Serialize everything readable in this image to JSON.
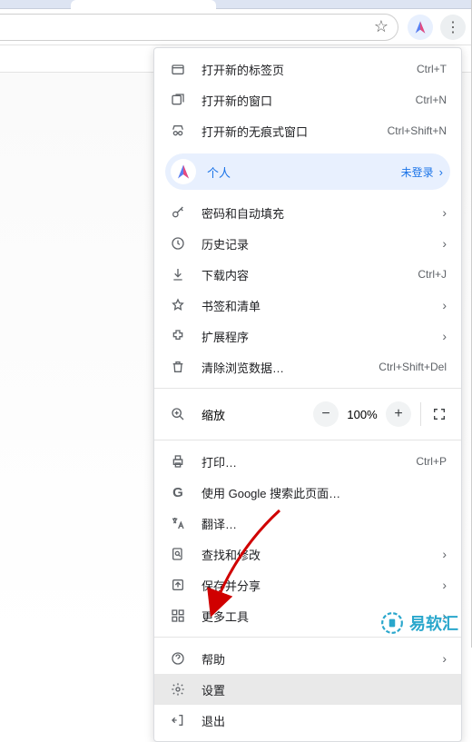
{
  "menu": {
    "new_tab": {
      "label": "打开新的标签页",
      "shortcut": "Ctrl+T"
    },
    "new_window": {
      "label": "打开新的窗口",
      "shortcut": "Ctrl+N"
    },
    "incognito": {
      "label": "打开新的无痕式窗口",
      "shortcut": "Ctrl+Shift+N"
    },
    "profile": {
      "label": "个人",
      "status": "未登录"
    },
    "passwords": {
      "label": "密码和自动填充"
    },
    "history": {
      "label": "历史记录"
    },
    "downloads": {
      "label": "下载内容",
      "shortcut": "Ctrl+J"
    },
    "bookmarks": {
      "label": "书签和清单"
    },
    "extensions": {
      "label": "扩展程序"
    },
    "clear_data": {
      "label": "清除浏览数据…",
      "shortcut": "Ctrl+Shift+Del"
    },
    "zoom": {
      "label": "缩放",
      "value": "100%"
    },
    "print": {
      "label": "打印…",
      "shortcut": "Ctrl+P"
    },
    "search": {
      "label": "使用 Google 搜索此页面…"
    },
    "translate": {
      "label": "翻译…"
    },
    "find": {
      "label": "查找和修改"
    },
    "save_share": {
      "label": "保存并分享"
    },
    "more_tools": {
      "label": "更多工具"
    },
    "help": {
      "label": "帮助"
    },
    "settings": {
      "label": "设置"
    },
    "exit": {
      "label": "退出"
    }
  },
  "watermark": {
    "text": "易软汇"
  }
}
